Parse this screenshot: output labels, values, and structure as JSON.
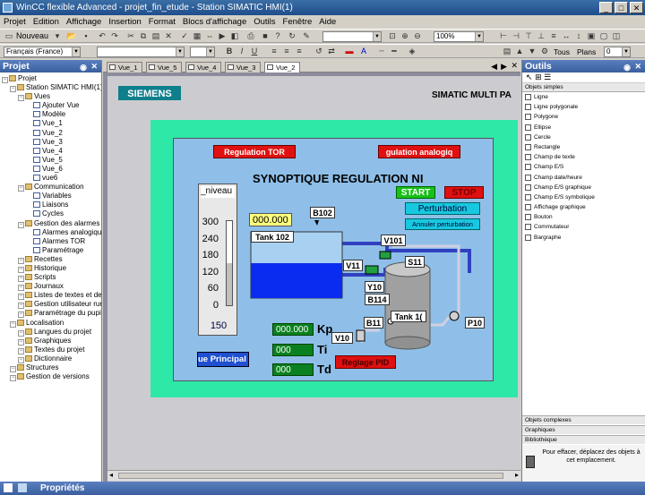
{
  "window": {
    "title": "WinCC flexible Advanced - projet_fin_etude - Station SIMATIC HMI(1)",
    "min": "_",
    "max": "□",
    "close": "✕"
  },
  "menu": [
    "Projet",
    "Edition",
    "Affichage",
    "Insertion",
    "Format",
    "Blocs d'affichage",
    "Outils",
    "Fenêtre",
    "Aide"
  ],
  "toolbar": {
    "new_label": "Nouveau",
    "language": "Français (France)",
    "zoom": "100%",
    "tous": "Tous",
    "plans": "Plans",
    "plans_value": "0"
  },
  "projet_panel": {
    "title": "Projet",
    "tree": [
      {
        "label": "Projet",
        "indent": 0
      },
      {
        "label": "Station SIMATIC HMI(1)(M",
        "indent": 1
      },
      {
        "label": "Vues",
        "indent": 2
      },
      {
        "label": "Ajouter Vue",
        "indent": 3
      },
      {
        "label": "Modèle",
        "indent": 3
      },
      {
        "label": "Vue_1",
        "indent": 3
      },
      {
        "label": "Vue_2",
        "indent": 3
      },
      {
        "label": "Vue_3",
        "indent": 3
      },
      {
        "label": "Vue_4",
        "indent": 3
      },
      {
        "label": "Vue_5",
        "indent": 3
      },
      {
        "label": "Vue_6",
        "indent": 3
      },
      {
        "label": "vue6",
        "indent": 3
      },
      {
        "label": "Communication",
        "indent": 2
      },
      {
        "label": "Variables",
        "indent": 3
      },
      {
        "label": "Liaisons",
        "indent": 3
      },
      {
        "label": "Cycles",
        "indent": 3
      },
      {
        "label": "Gestion des alarmes",
        "indent": 2
      },
      {
        "label": "Alarmes analogiques",
        "indent": 3
      },
      {
        "label": "Alarmes TOR",
        "indent": 3
      },
      {
        "label": "Paramétrage",
        "indent": 3
      },
      {
        "label": "Recettes",
        "indent": 2
      },
      {
        "label": "Historique",
        "indent": 2
      },
      {
        "label": "Scripts",
        "indent": 2
      },
      {
        "label": "Journaux",
        "indent": 2
      },
      {
        "label": "Listes de textes et de g",
        "indent": 2
      },
      {
        "label": "Gestion utilisateur runti",
        "indent": 2
      },
      {
        "label": "Paramétrage du pupitre",
        "indent": 2
      },
      {
        "label": "Localisation",
        "indent": 1
      },
      {
        "label": "Langues du projet",
        "indent": 2
      },
      {
        "label": "Graphiques",
        "indent": 2
      },
      {
        "label": "Textes du projet",
        "indent": 2
      },
      {
        "label": "Dictionnaire",
        "indent": 2
      },
      {
        "label": "Structures",
        "indent": 1
      },
      {
        "label": "Gestion de versions",
        "indent": 1
      }
    ]
  },
  "tabs": [
    "Vue_1",
    "Vue_5",
    "Vue_4",
    "Vue_3",
    "Vue_2"
  ],
  "screen": {
    "siemens": "SIEMENS",
    "simatic_title": "SIMATIC MULTI PA",
    "btn_regulation_tor": "Regulation TOR",
    "btn_regulation_analog": "gulation analogiq",
    "main_title": "SYNOPTIQUE REGULATION NI",
    "btn_start": "START",
    "btn_stop": "STOP",
    "btn_perturbation": "Perturbation",
    "btn_annuler": "Annuler perturbation",
    "gauge_label": "_niveau",
    "gauge_ticks": [
      "300",
      "240",
      "180",
      "120",
      "60",
      "0"
    ],
    "gauge_value": "150",
    "level_fraction": 0.5,
    "value_box": "000.000",
    "b102": "B102",
    "tank102": "Tank 102",
    "v101": "V101",
    "v11": "V11",
    "s11": "S11",
    "y10": "Y10",
    "b114": "B114",
    "tank1": "Tank 1(",
    "b11": "B11",
    "p10": "P10",
    "v10": "V10",
    "kp_value": "000.000",
    "kp_label": "Kp",
    "ti_value": "000",
    "ti_label": "Ti",
    "td_value": "000",
    "td_label": "Td",
    "btn_vue_principal": "ue Principal",
    "btn_reglage_pid": "Reglage PID"
  },
  "outils_panel": {
    "title": "Outils",
    "section_simple": "Objets simples",
    "items": [
      "Ligne",
      "Ligne polygonale",
      "Polygone",
      "Ellipse",
      "Cercle",
      "Rectangle",
      "Champ de texte",
      "Champ E/S",
      "Champ date/heure",
      "Champ E/S graphique",
      "Champ E/S symbolique",
      "Affichage graphique",
      "Bouton",
      "Commutateur",
      "Bargraphe"
    ],
    "section_complexes": "Objets complexes",
    "section_graphiques": "Graphiques",
    "section_bibliotheque": "Bibliothèque",
    "hint": "Pour effacer, déplacez des objets à cet emplacement."
  },
  "bottom": {
    "proprietes": "Propriétés"
  },
  "colors": {
    "title_bar": "#1f4e8c",
    "hmi_bg": "#8fbfe8",
    "frame": "#2ee8a8",
    "red": "#e01010",
    "green": "#18c018",
    "cyan": "#18c8e0",
    "water": "#0a2cf0"
  }
}
